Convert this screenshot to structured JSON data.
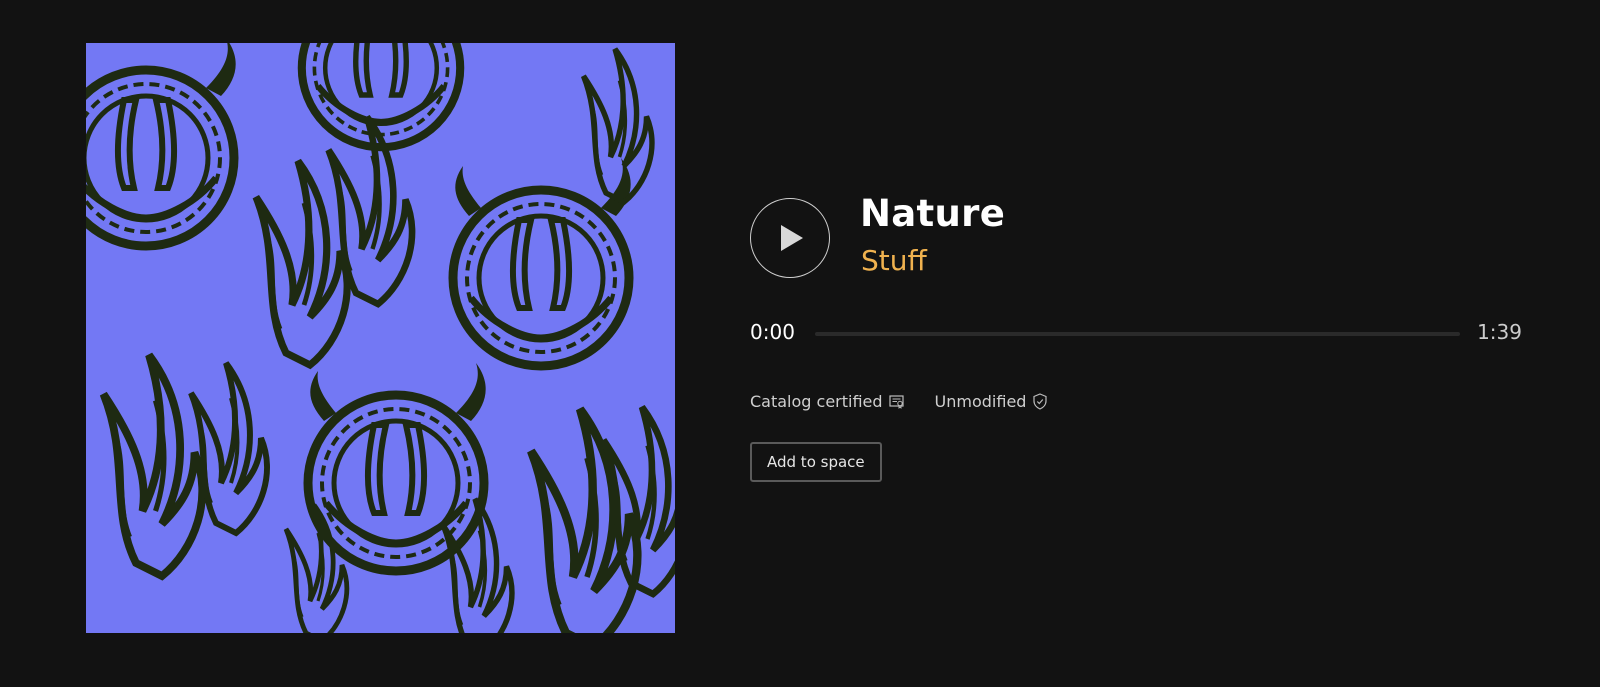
{
  "track": {
    "title": "Nature",
    "artist": "Stuff"
  },
  "playback": {
    "current_time": "0:00",
    "total_time": "1:39",
    "progress": 0
  },
  "badges": [
    {
      "label": "Catalog certified",
      "icon": "certificate-icon"
    },
    {
      "label": "Unmodified",
      "icon": "shield-check-icon"
    }
  ],
  "actions": {
    "add_to_space_label": "Add to space"
  },
  "colors": {
    "background": "#121212",
    "artwork_bg": "#7378f4",
    "artwork_pattern": "#1e2a12",
    "artist_accent": "#f0b24f"
  },
  "icons": {
    "play": "play-icon"
  }
}
